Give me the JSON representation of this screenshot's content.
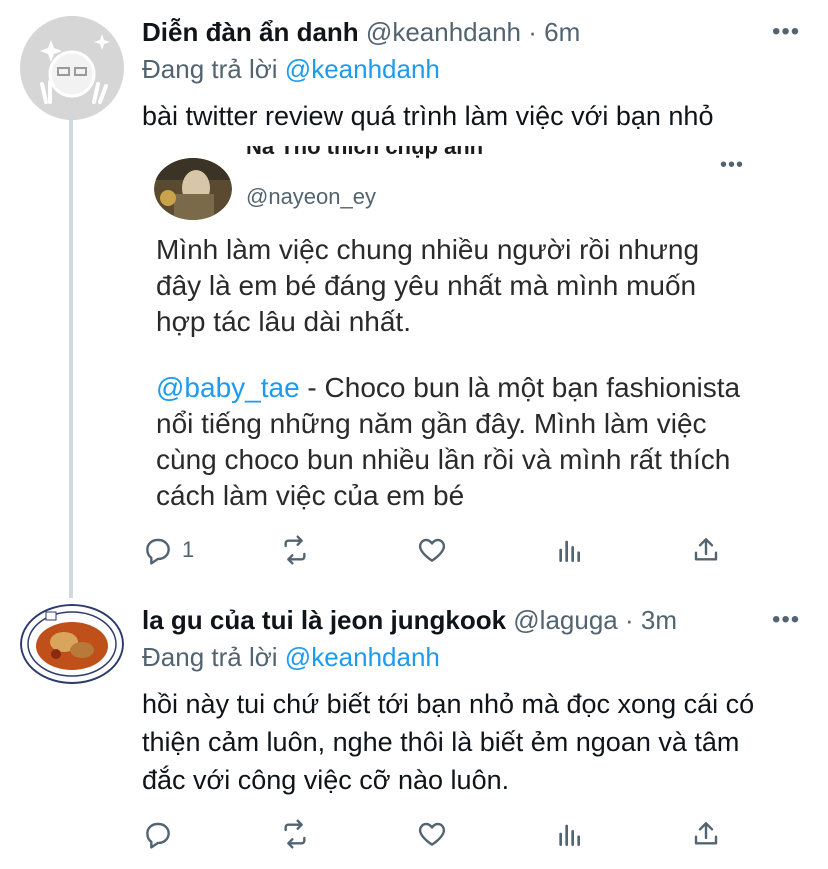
{
  "tweet1": {
    "display_name": "Diễn đàn ẩn danh",
    "handle": "@keanhdanh",
    "time": "· 6m",
    "replying_label": "Đang trả lời",
    "replying_to": "@keanhdanh",
    "text": "bài twitter review quá trình làm việc với bạn nhỏ",
    "reply_count": "1",
    "embedded": {
      "display_name": "Na Thỏ thích chụp ảnh",
      "handle": "@nayeon_ey",
      "para1": "Mình làm việc chung nhiều người rồi nhưng đây là em bé đáng yêu nhất mà mình muốn hợp tác lâu dài nhất.",
      "mention": "@baby_tae",
      "para2_rest": " - Choco bun là một bạn fashionista nổi tiếng những năm gần đây. Mình làm việc cùng choco bun nhiều lần rồi và mình rất thích cách làm việc của em bé"
    }
  },
  "tweet2": {
    "display_name": "la gu của tui là jeon jungkook",
    "handle": "@laguga",
    "time": "· 3m",
    "replying_label": "Đang trả lời",
    "replying_to": "@keanhdanh",
    "text": "hồi này tui chứ biết tới bạn nhỏ mà đọc xong cái có thiện cảm luôn, nghe thôi là biết ẻm ngoan và tâm đắc với công việc cỡ nào luôn.",
    "reply_count": ""
  },
  "icons": [
    "more-icon",
    "reply-icon",
    "retweet-icon",
    "like-icon",
    "analytics-icon",
    "share-icon"
  ],
  "colors": {
    "link": "#1d9bf0",
    "muted": "#536471",
    "thread_line": "#cfd9de"
  }
}
